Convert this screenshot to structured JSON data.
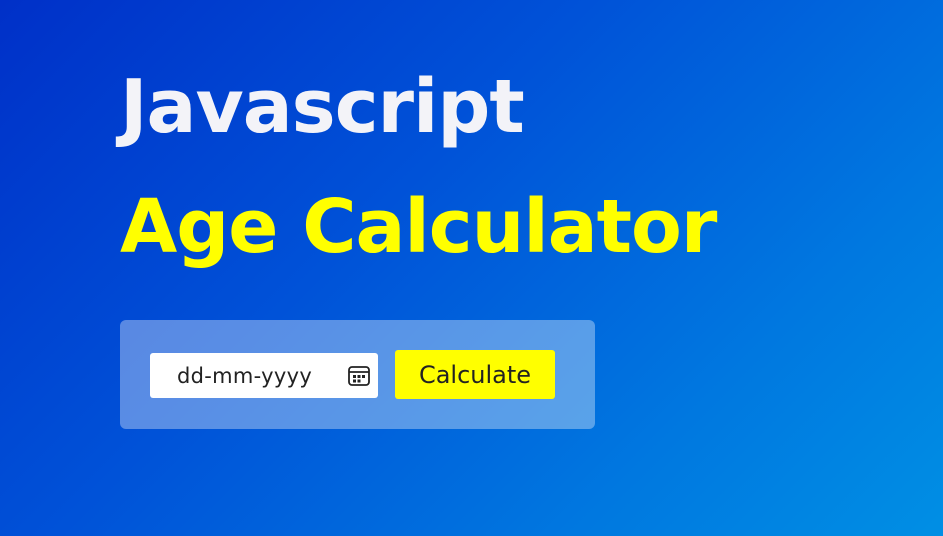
{
  "header": {
    "title_line1": "Javascript",
    "title_line2": "Age Calculator"
  },
  "form": {
    "date_placeholder": "dd-mm-yyyy",
    "date_icon": "calendar-icon",
    "calculate_label": "Calculate"
  },
  "colors": {
    "background_start": "#0030c8",
    "background_end": "#008fe4",
    "title_line1": "#f3f3f8",
    "title_line2": "#ffff00",
    "button": "#ffff00"
  }
}
